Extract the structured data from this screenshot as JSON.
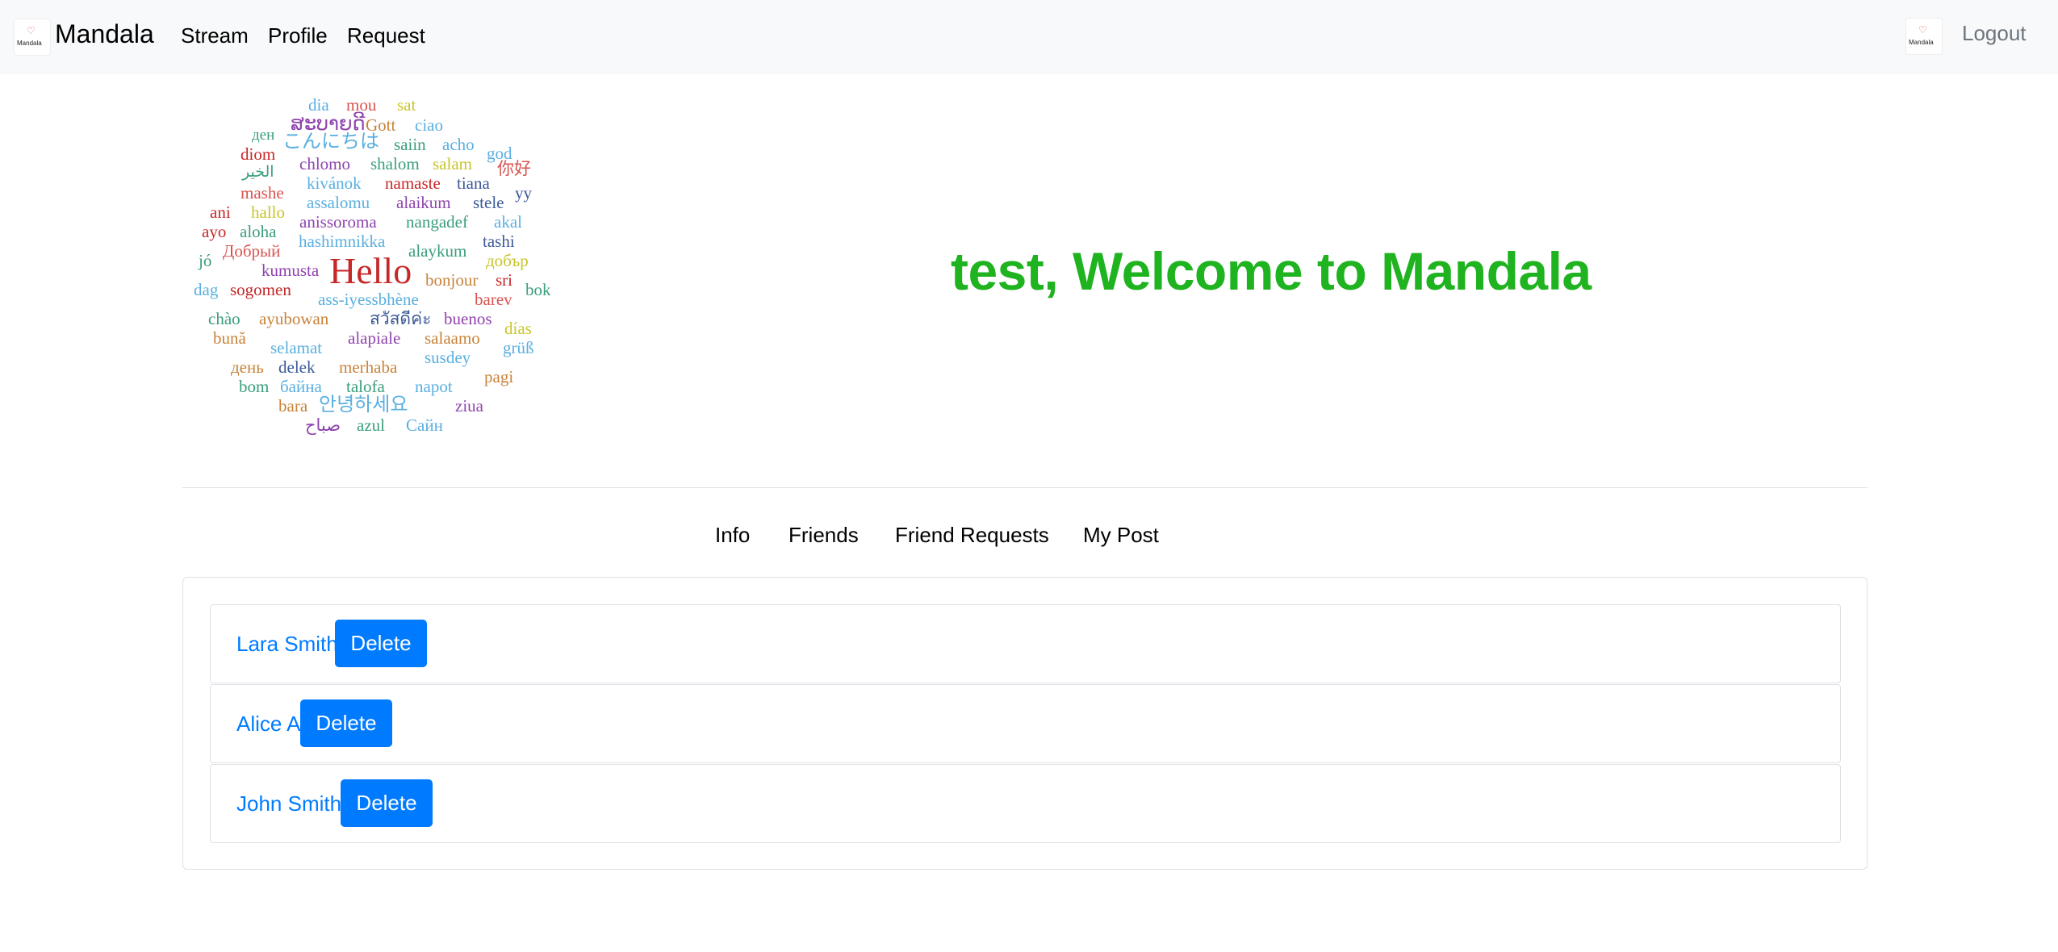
{
  "navbar": {
    "brand": "Mandala",
    "logo_text": "Mandala",
    "links": [
      "Stream",
      "Profile",
      "Request"
    ],
    "logout": "Logout"
  },
  "word_cloud": [
    {
      "text": "dia",
      "color": "#5aafe0"
    },
    {
      "text": "mou",
      "color": "#d9534f"
    },
    {
      "text": "sat",
      "color": "#c9c52c"
    },
    {
      "text": "ສະບາຍດີ",
      "color": "#8e44ad"
    },
    {
      "text": "Gott",
      "color": "#c8833a"
    },
    {
      "text": "ciao",
      "color": "#5aafe0"
    },
    {
      "text": "ден",
      "color": "#3a9e7a"
    },
    {
      "text": "こんにちは",
      "color": "#5aafe0"
    },
    {
      "text": "saiin",
      "color": "#3a9e7a"
    },
    {
      "text": "acho",
      "color": "#5aafe0"
    },
    {
      "text": "diom",
      "color": "#c62828"
    },
    {
      "text": "god",
      "color": "#5aafe0"
    },
    {
      "text": "الخير",
      "color": "#3a9e7a"
    },
    {
      "text": "chlomo",
      "color": "#8e44ad"
    },
    {
      "text": "shalom",
      "color": "#3a9e7a"
    },
    {
      "text": "salam",
      "color": "#c9c52c"
    },
    {
      "text": "你好",
      "color": "#d9534f"
    },
    {
      "text": "mashe",
      "color": "#d9534f"
    },
    {
      "text": "kivánok",
      "color": "#5aafe0"
    },
    {
      "text": "namaste",
      "color": "#c62828"
    },
    {
      "text": "tiana",
      "color": "#3b5998"
    },
    {
      "text": "yy",
      "color": "#3b5998"
    },
    {
      "text": "ani",
      "color": "#c62828"
    },
    {
      "text": "hallo",
      "color": "#c9c52c"
    },
    {
      "text": "assalomu",
      "color": "#5aafe0"
    },
    {
      "text": "alaikum",
      "color": "#8e44ad"
    },
    {
      "text": "stele",
      "color": "#3b5998"
    },
    {
      "text": "ayo",
      "color": "#c62828"
    },
    {
      "text": "aloha",
      "color": "#3a9e7a"
    },
    {
      "text": "anissoroma",
      "color": "#8e44ad"
    },
    {
      "text": "nangadef",
      "color": "#3a9e7a"
    },
    {
      "text": "akal",
      "color": "#5aafe0"
    },
    {
      "text": "Добрый",
      "color": "#d9534f"
    },
    {
      "text": "hashimnikka",
      "color": "#5aafe0"
    },
    {
      "text": "alaykum",
      "color": "#3a9e7a"
    },
    {
      "text": "tashi",
      "color": "#3b5998"
    },
    {
      "text": "jó",
      "color": "#3a9e7a"
    },
    {
      "text": "kumusta",
      "color": "#8e44ad"
    },
    {
      "text": "Hello",
      "color": "#c62828"
    },
    {
      "text": "bonjour",
      "color": "#c8833a"
    },
    {
      "text": "добър",
      "color": "#c9c52c"
    },
    {
      "text": "dag",
      "color": "#5aafe0"
    },
    {
      "text": "sogomen",
      "color": "#c62828"
    },
    {
      "text": "sri",
      "color": "#c62828"
    },
    {
      "text": "bok",
      "color": "#3a9e7a"
    },
    {
      "text": "ass-iyessbhène",
      "color": "#5aafe0"
    },
    {
      "text": "barev",
      "color": "#d9534f"
    },
    {
      "text": "chào",
      "color": "#3a9e7a"
    },
    {
      "text": "ayubowan",
      "color": "#c8833a"
    },
    {
      "text": "สวัสดีค่ะ",
      "color": "#3b5998"
    },
    {
      "text": "buenos",
      "color": "#8e44ad"
    },
    {
      "text": "días",
      "color": "#c9c52c"
    },
    {
      "text": "bună",
      "color": "#c8833a"
    },
    {
      "text": "selamat",
      "color": "#5aafe0"
    },
    {
      "text": "alapiale",
      "color": "#8e44ad"
    },
    {
      "text": "salaamo",
      "color": "#c8833a"
    },
    {
      "text": "grüß",
      "color": "#5aafe0"
    },
    {
      "text": "susdey",
      "color": "#5aafe0"
    },
    {
      "text": "день",
      "color": "#c8833a"
    },
    {
      "text": "delek",
      "color": "#3b5998"
    },
    {
      "text": "merhaba",
      "color": "#c8833a"
    },
    {
      "text": "pagi",
      "color": "#c8833a"
    },
    {
      "text": "bom",
      "color": "#3a9e7a"
    },
    {
      "text": "байна",
      "color": "#5aafe0"
    },
    {
      "text": "talofa",
      "color": "#3a9e7a"
    },
    {
      "text": "napot",
      "color": "#5aafe0"
    },
    {
      "text": "bara",
      "color": "#c8833a"
    },
    {
      "text": "안녕하세요",
      "color": "#5aafe0"
    },
    {
      "text": "ziua",
      "color": "#8e44ad"
    },
    {
      "text": "صباح",
      "color": "#8e44ad"
    },
    {
      "text": "azul",
      "color": "#3a9e7a"
    },
    {
      "text": "Сайн",
      "color": "#5aafe0"
    }
  ],
  "welcome": "test, Welcome to Mandala",
  "tabs": [
    "Info",
    "Friends",
    "Friend Requests",
    "My Post"
  ],
  "friends": [
    {
      "name": "Lara Smith",
      "action": "Delete"
    },
    {
      "name": "Alice A",
      "action": "Delete"
    },
    {
      "name": "John Smith",
      "action": "Delete"
    }
  ],
  "colors": {
    "welcome": "#1fb31f",
    "link": "#007bff",
    "button": "#007bff",
    "navbar_bg": "#f8f9fa"
  }
}
